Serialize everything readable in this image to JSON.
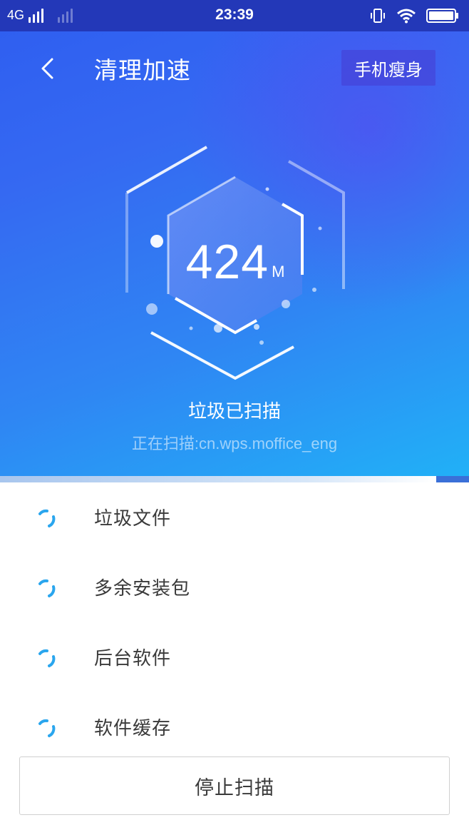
{
  "status_bar": {
    "network": "4G",
    "time": "23:39"
  },
  "header": {
    "title": "清理加速",
    "slim_button_label": "手机瘦身",
    "back_icon": "chevron-left-icon"
  },
  "scan": {
    "size_value": "424",
    "size_unit": "M",
    "status_text": "垃圾已扫描",
    "current_path": "正在扫描:cn.wps.moffice_eng",
    "progress_fraction": 0.93
  },
  "items": [
    {
      "label": "垃圾文件",
      "icon": "loading-spinner-icon"
    },
    {
      "label": "多余安装包",
      "icon": "loading-spinner-icon"
    },
    {
      "label": "后台软件",
      "icon": "loading-spinner-icon"
    },
    {
      "label": "软件缓存",
      "icon": "loading-spinner-icon"
    }
  ],
  "stop_button_label": "停止扫描",
  "colors": {
    "status_bar": "#2338b8",
    "hero_top": "#2e5df0",
    "hero_bottom": "#21b1f7",
    "spinner": "#2aa6ee"
  }
}
